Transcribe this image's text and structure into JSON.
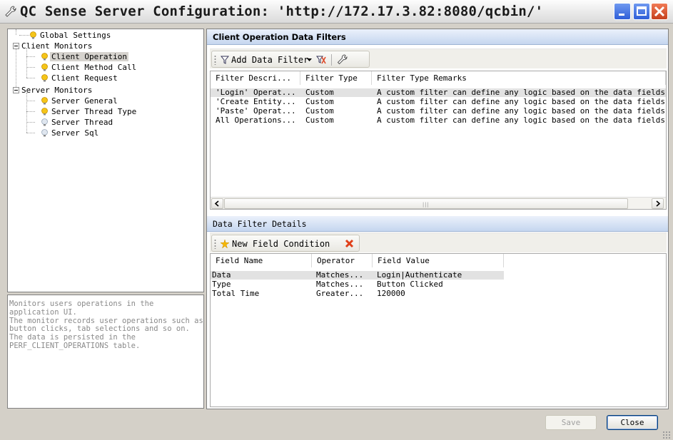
{
  "window": {
    "title": "QC Sense Server Configuration: 'http://172.17.3.82:8080/qcbin/'",
    "title_icon": "wrench-icon"
  },
  "tree": {
    "items": [
      {
        "label": "Global Settings",
        "icon": "bulb-icon"
      },
      {
        "label": "Client Monitors",
        "icon": "none"
      },
      {
        "label": "Client Operation",
        "icon": "bulb-icon",
        "selected": true
      },
      {
        "label": "Client Method Call",
        "icon": "bulb-icon"
      },
      {
        "label": "Client Request",
        "icon": "bulb-icon"
      },
      {
        "label": "Server Monitors",
        "icon": "none"
      },
      {
        "label": "Server General",
        "icon": "bulb-icon"
      },
      {
        "label": "Server Thread Type",
        "icon": "bulb-icon"
      },
      {
        "label": "Server Thread",
        "icon": "bulb-off-icon"
      },
      {
        "label": "Server Sql",
        "icon": "bulb-off-icon"
      }
    ]
  },
  "description": "Monitors users operations in the application UI.\nThe monitor records user operations such as button clicks, tab selections and so on.\nThe data is persisted in the PERF_CLIENT_OPERATIONS table.",
  "filters": {
    "header": "Client Operation Data Filters",
    "toolbar": {
      "add_label": "Add Data Filter",
      "add_icon": "funnel-icon",
      "dropdown_icon": "chevron-down-icon",
      "remove_icon": "remove-filter-icon",
      "settings_icon": "wrench-icon"
    },
    "columns": [
      "Filter Descri...",
      "Filter Type",
      "Filter Type Remarks"
    ],
    "rows": [
      {
        "desc": "'Login' Operat...",
        "type": "Custom",
        "remarks": "A custom filter can define any logic based on the data fields.",
        "selected": true
      },
      {
        "desc": "'Create Entity...",
        "type": "Custom",
        "remarks": "A custom filter can define any logic based on the data fields."
      },
      {
        "desc": "'Paste' Operat...",
        "type": "Custom",
        "remarks": "A custom filter can define any logic based on the data fields."
      },
      {
        "desc": "All Operations...",
        "type": "Custom",
        "remarks": "A custom filter can define any logic based on the data fields."
      }
    ]
  },
  "details": {
    "header": "Data Filter Details",
    "toolbar": {
      "new_label": "New Field Condition",
      "new_icon": "star-icon",
      "delete_icon": "delete-x-icon"
    },
    "columns": [
      "Field Name",
      "Operator",
      "Field Value"
    ],
    "rows": [
      {
        "field": "Data",
        "operator": "Matches...",
        "value": "Login|Authenticate",
        "selected": true
      },
      {
        "field": "Type",
        "operator": "Matches...",
        "value": "Button Clicked"
      },
      {
        "field": "Total Time",
        "operator": "Greater...",
        "value": "120000"
      }
    ]
  },
  "buttons": {
    "save": "Save",
    "close": "Close"
  }
}
